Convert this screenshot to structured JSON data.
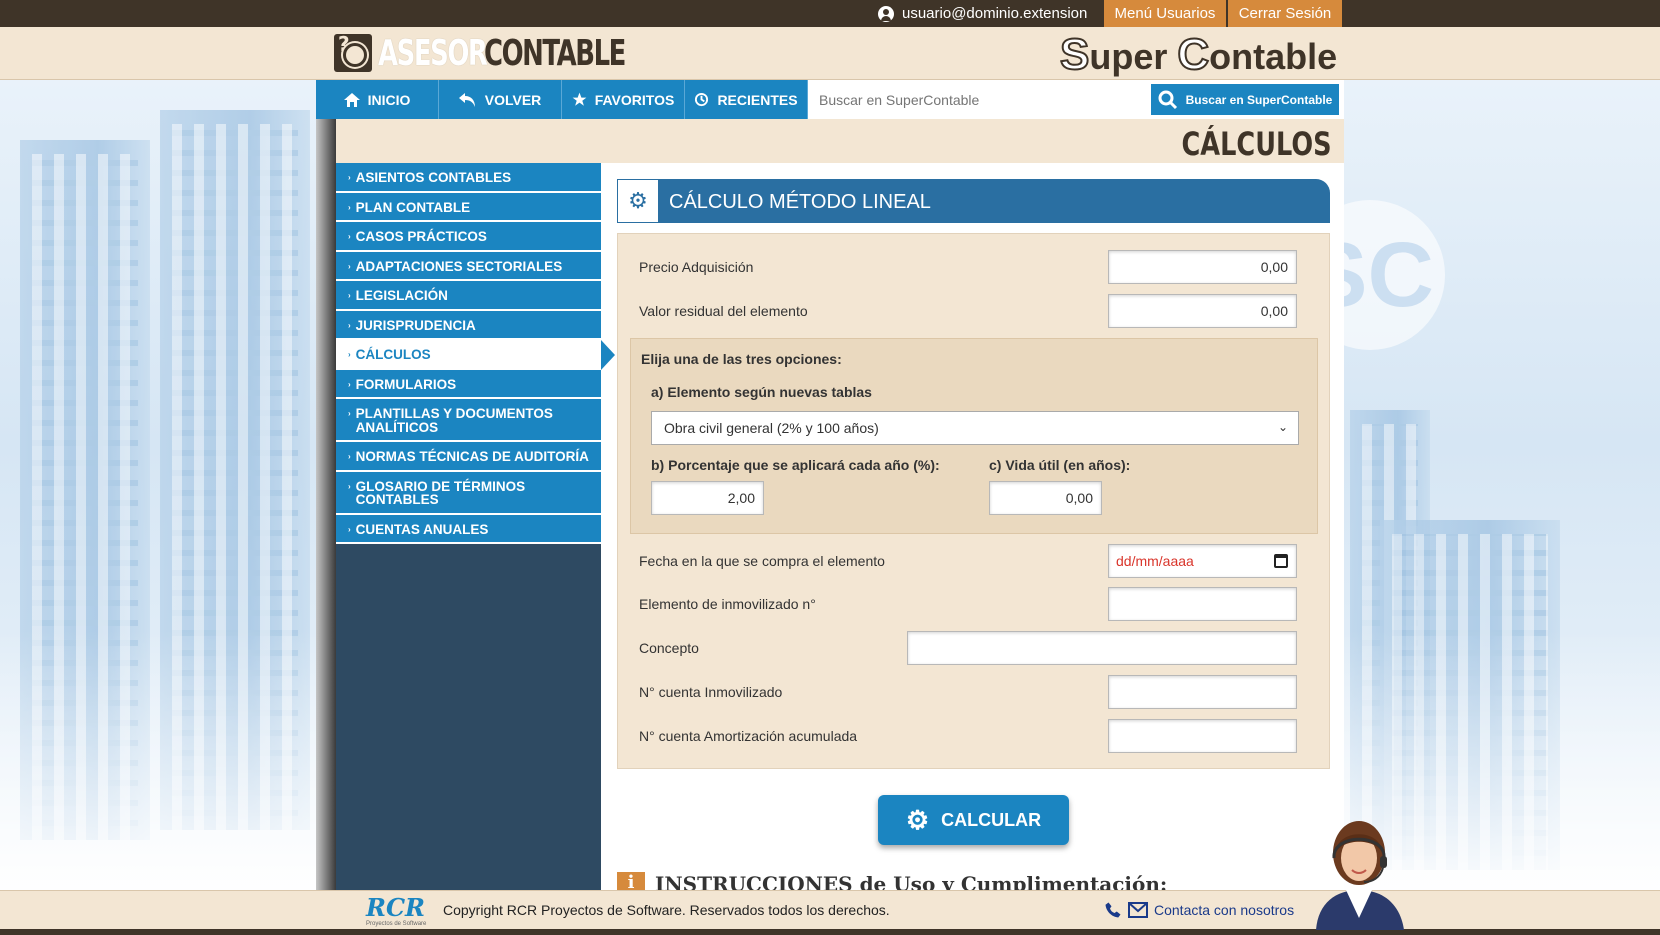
{
  "topbar": {
    "user_email": "usuario@dominio.extension",
    "menu_users": "Menú Usuarios",
    "logout": "Cerrar Sesión"
  },
  "header": {
    "logo_left_a": "ASESOR",
    "logo_left_b": "CONTABLE",
    "logo_right_s": "S",
    "logo_right_a": "uper ",
    "logo_right_c": "C",
    "logo_right_b": "ontable"
  },
  "nav": {
    "home": "INICIO",
    "back": "VOLVER",
    "favorites": "FAVORITOS",
    "recent": "RECIENTES",
    "search_placeholder": "Buscar en SuperContable",
    "search_button": "Buscar en SuperContable"
  },
  "page": {
    "title": "CÁLCULOS"
  },
  "sidebar": {
    "items": [
      "ASIENTOS CONTABLES",
      "PLAN CONTABLE",
      "CASOS PRÁCTICOS",
      "ADAPTACIONES SECTORIALES",
      "LEGISLACIÓN",
      "JURISPRUDENCIA",
      "CÁLCULOS",
      "FORMULARIOS",
      "PLANTILLAS Y DOCUMENTOS ANALÍTICOS",
      "NORMAS TÉCNICAS DE AUDITORÍA",
      "GLOSARIO DE TÉRMINOS CONTABLES",
      "CUENTAS ANUALES"
    ],
    "active_index": 6
  },
  "section": {
    "title": "CÁLCULO MÉTODO LINEAL"
  },
  "form": {
    "precio_label": "Precio Adquisición",
    "precio_value": "0,00",
    "residual_label": "Valor residual del elemento",
    "residual_value": "0,00",
    "options_title": "Elija una de las tres opciones:",
    "option_a_label": "a) Elemento según nuevas tablas",
    "option_a_value": "Obra civil general (2% y 100 años)",
    "option_b_label": "b) Porcentaje que se aplicará cada año (%):",
    "option_b_value": "2,00",
    "option_c_label": "c) Vida útil (en años):",
    "option_c_value": "0,00",
    "fecha_label": "Fecha en la que se compra el elemento",
    "fecha_placeholder": "dd/mm/aaaa",
    "elemento_label": "Elemento de inmovilizado n°",
    "concepto_label": "Concepto",
    "cuenta_inmov_label": "N° cuenta Inmovilizado",
    "cuenta_amort_label": "N° cuenta Amortización acumulada"
  },
  "calc_button": "CALCULAR",
  "instructions_title": "INSTRUCCIONES de Uso y Cumplimentación:",
  "footer": {
    "rcr_logo": "RCR",
    "rcr_sub": "Proyectos de Software",
    "copyright": "Copyright RCR Proyectos de Software. Reservados todos los derechos.",
    "contact": "Contacta con nosotros"
  },
  "colors": {
    "brand_blue": "#1b85c1",
    "brown": "#3f3428",
    "cream": "#f3e6d3",
    "orange": "#d68a3c"
  }
}
